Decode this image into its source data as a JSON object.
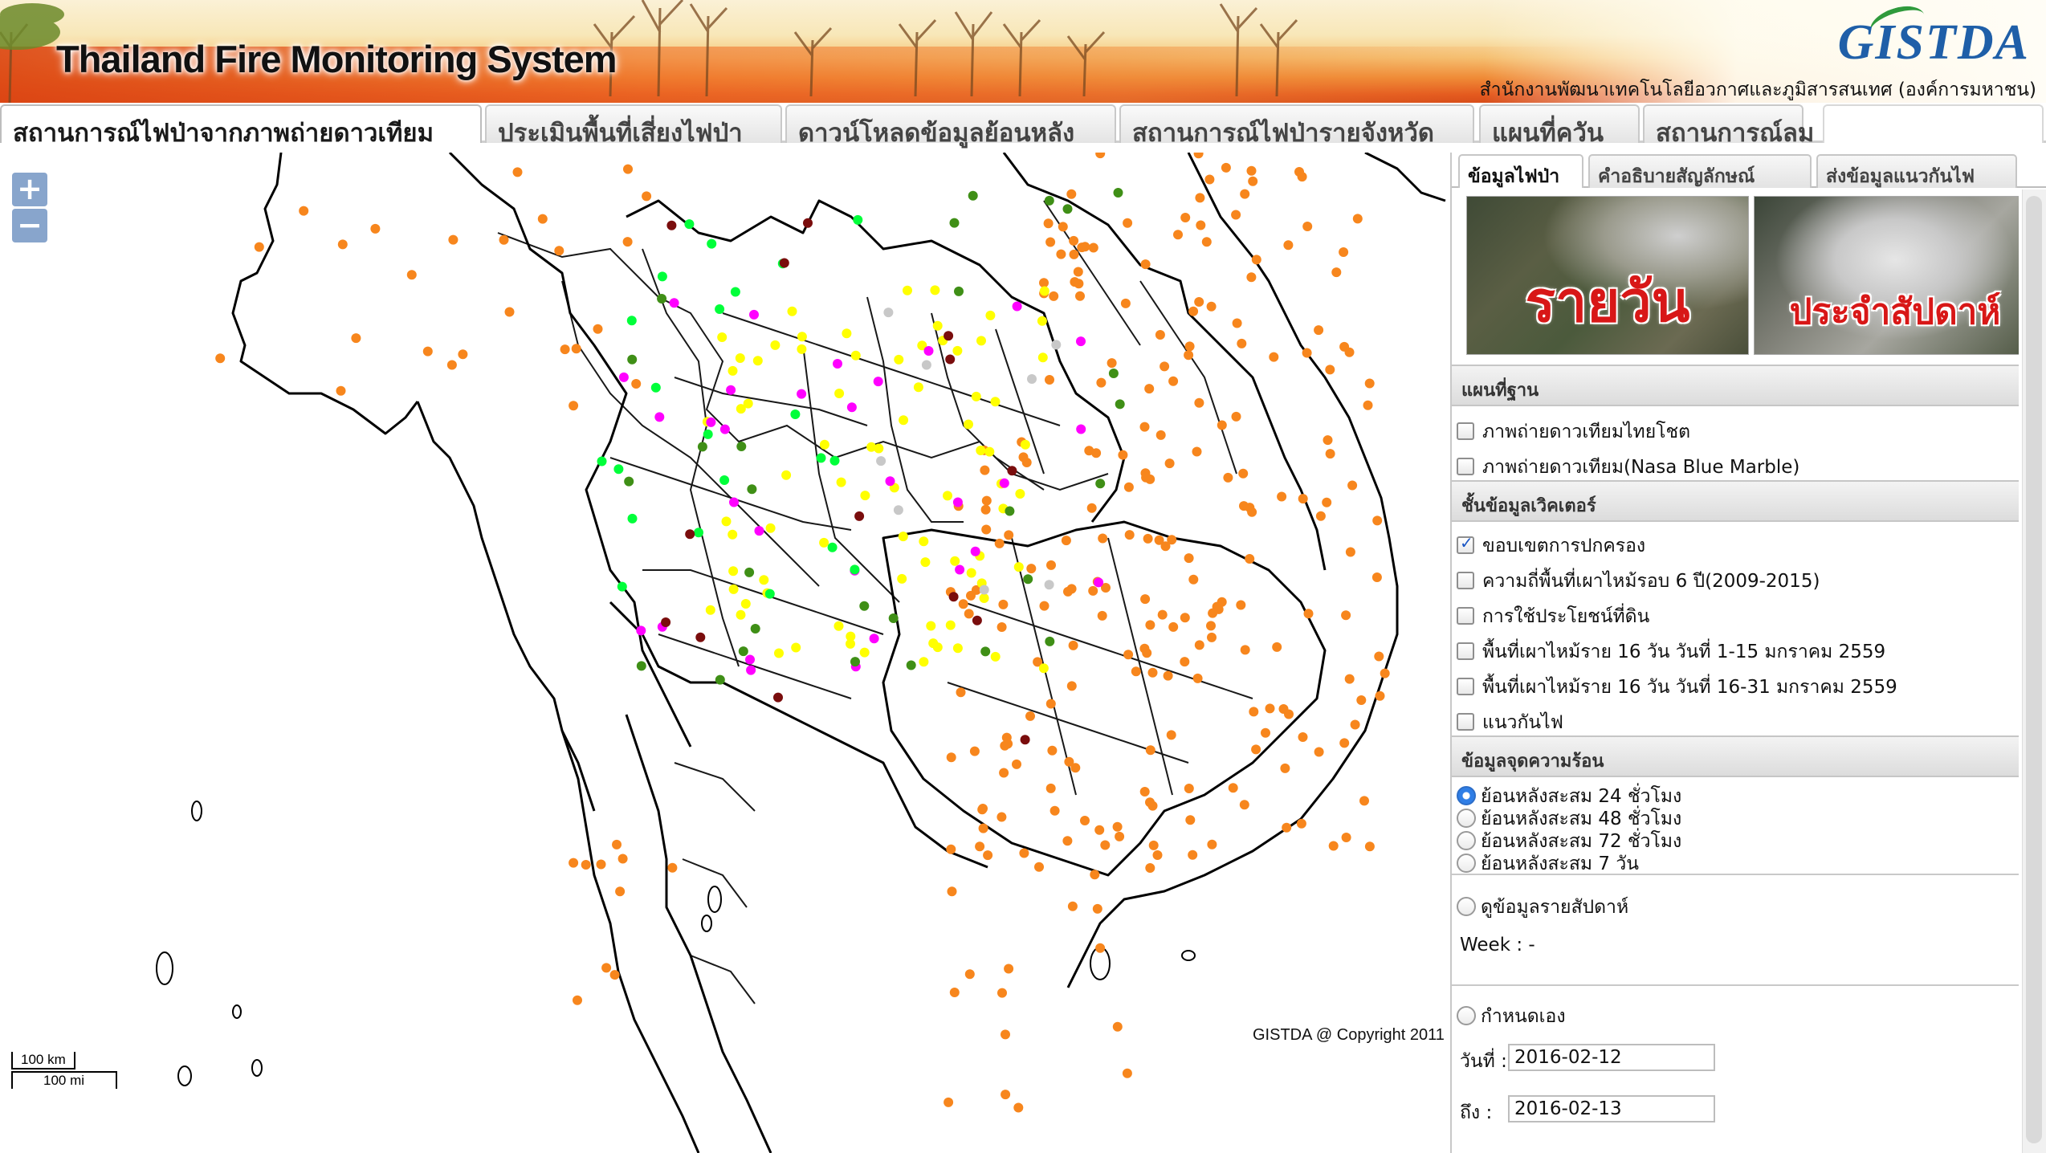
{
  "header": {
    "app_title": "Thailand Fire Monitoring System",
    "logo_text": "GISTDA",
    "agency": "สำนักงานพัฒนาเทคโนโลยีอวกาศและภูมิสารสนเทศ (องค์การมหาชน)"
  },
  "main_tabs": [
    {
      "label": "สถานการณ์ไฟป่าจากภาพถ่ายดาวเทียม",
      "active": true
    },
    {
      "label": "ประเมินพื้นที่เสี่ยงไฟป่า",
      "active": false
    },
    {
      "label": "ดาวน์โหลดข้อมูลย้อนหลัง",
      "active": false
    },
    {
      "label": "สถานการณ์ไฟป่ารายจังหวัด",
      "active": false
    },
    {
      "label": "แผนที่ควัน",
      "active": false
    },
    {
      "label": "สถานการณ์ลม",
      "active": false
    }
  ],
  "map": {
    "zoom_in": "+",
    "zoom_out": "−",
    "copyright": "GISTDA @ Copyright 2011",
    "scale_km": "100 km",
    "scale_mi": "100 mi",
    "legend_colors": {
      "orange": "#f7861d",
      "yellow": "#ffff00",
      "magenta": "#ff00ff",
      "green": "#00ff3a",
      "dark_green": "#3f8f16",
      "maroon": "#7a0d0d",
      "grey": "#c8c8c8"
    }
  },
  "side_panel": {
    "tabs": [
      {
        "label": "ข้อมูลไฟป่า",
        "active": true
      },
      {
        "label": "คำอธิบายสัญลักษณ์",
        "active": false
      },
      {
        "label": "ส่งข้อมูลแนวกันไฟ",
        "active": false
      }
    ],
    "thumbnails": {
      "daily": "รายวัน",
      "weekly": "ประจำสัปดาห์"
    },
    "basemap": {
      "heading": "แผนที่ฐาน",
      "options": [
        {
          "label": "ภาพถ่ายดาวเทียมไทยโชต",
          "checked": false
        },
        {
          "label": "ภาพถ่ายดาวเทียม(Nasa Blue Marble)",
          "checked": false
        }
      ]
    },
    "vector": {
      "heading": "ชั้นข้อมูลเวิคเตอร์",
      "options": [
        {
          "label": "ขอบเขตการปกครอง",
          "checked": true
        },
        {
          "label": "ความถี่พื้นที่เผาไหม้รอบ 6 ปี(2009-2015)",
          "checked": false
        },
        {
          "label": "การใช้ประโยชน์ที่ดิน",
          "checked": false
        },
        {
          "label": "พื้นที่เผาไหม้ราย 16 วัน วันที่ 1-15 มกราคม 2559",
          "checked": false
        },
        {
          "label": "พื้นที่เผาไหม้ราย 16 วัน วันที่ 16-31 มกราคม 2559",
          "checked": false
        },
        {
          "label": "แนวกันไฟ",
          "checked": false
        }
      ]
    },
    "hotspot": {
      "heading": "ข้อมูลจุดความร้อน",
      "options": [
        {
          "label": "ย้อนหลังสะสม 24 ชั่วโมง",
          "checked": true
        },
        {
          "label": "ย้อนหลังสะสม 48 ชั่วโมง",
          "checked": false
        },
        {
          "label": "ย้อนหลังสะสม 72 ชั่วโมง",
          "checked": false
        },
        {
          "label": "ย้อนหลังสะสม 7 วัน",
          "checked": false
        }
      ],
      "weekly_option": "ดูข้อมูลรายสัปดาห์",
      "week_label": "Week : -",
      "custom_option": "กำหนดเอง",
      "date_from_label": "วันที่ :",
      "date_from_value": "2016-02-12",
      "date_to_label": "ถึง :",
      "date_to_value": "2016-02-13"
    }
  }
}
